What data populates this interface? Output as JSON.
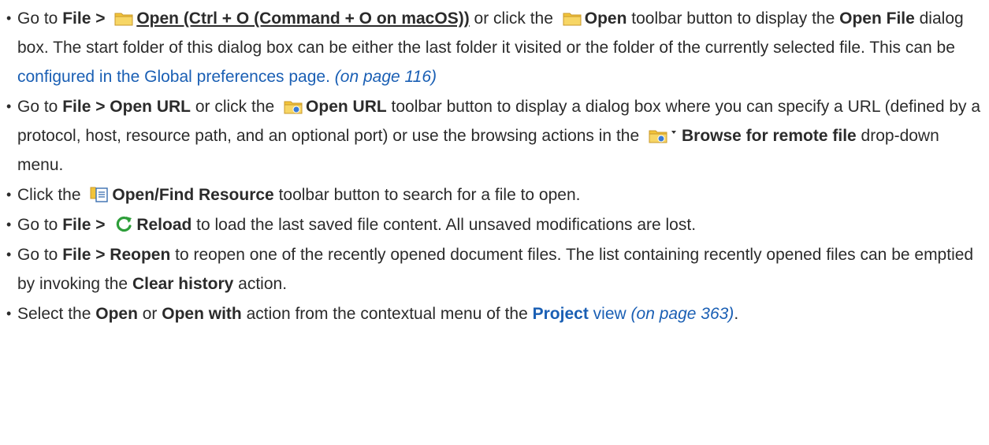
{
  "items": [
    {
      "a_go": "Go to ",
      "a_file": "File > ",
      "a_folder_icon": "folder-icon",
      "a_open_shortcut": "Open (Ctrl + O (Command + O on macOS))",
      "a_or_click": " or click the ",
      "a_toolbar_icon": "folder-icon",
      "a_open": "Open",
      "a_text1": " toolbar button to display the ",
      "a_open_file": "Open File",
      "a_text2": " dialog box. The start folder of this dialog box can be either the last folder it visited or the folder of the currently selected file. This can be ",
      "a_link": "configured in the Global preferences page.",
      "a_pageref": "(on page 116)"
    },
    {
      "b_go": "Go to ",
      "b_menu": "File > Open URL",
      "b_or_click": " or click the ",
      "b_icon": "folder-url-icon",
      "b_open_url": "Open URL",
      "b_text1": " toolbar button to display a dialog box where you can specify a URL (defined by a protocol, host, resource path, and an optional port) or use the browsing actions in the ",
      "b_browse_icon": "folder-url-dropdown-icon",
      "b_browse": "Browse for remote file",
      "b_text2": " drop-down menu."
    },
    {
      "c_click": "Click the ",
      "c_icon": "open-find-resource-icon",
      "c_label": "Open/Find Resource",
      "c_text": " toolbar button to search for a file to open."
    },
    {
      "d_go": "Go to ",
      "d_file": "File > ",
      "d_icon": "reload-icon",
      "d_reload": "Reload",
      "d_text": " to load the last saved file content. All unsaved modifications are lost."
    },
    {
      "e_go": "Go to ",
      "e_menu": "File > Reopen",
      "e_text1": " to reopen one of the recently opened document files. The list containing recently opened files can be emptied by invoking the ",
      "e_clear": "Clear history",
      "e_text2": " action."
    },
    {
      "f_select": "Select the ",
      "f_open": "Open",
      "f_or": " or ",
      "f_openwith": "Open with",
      "f_text": " action from the contextual menu of the ",
      "f_project": "Project",
      "f_view": " view",
      "f_pageref": "(on page 363)",
      "f_end": "."
    }
  ],
  "colors": {
    "text": "#2b2b2b",
    "link": "#1a5fb4",
    "folder": "#f2c43a",
    "reload": "#2e9e3a"
  }
}
